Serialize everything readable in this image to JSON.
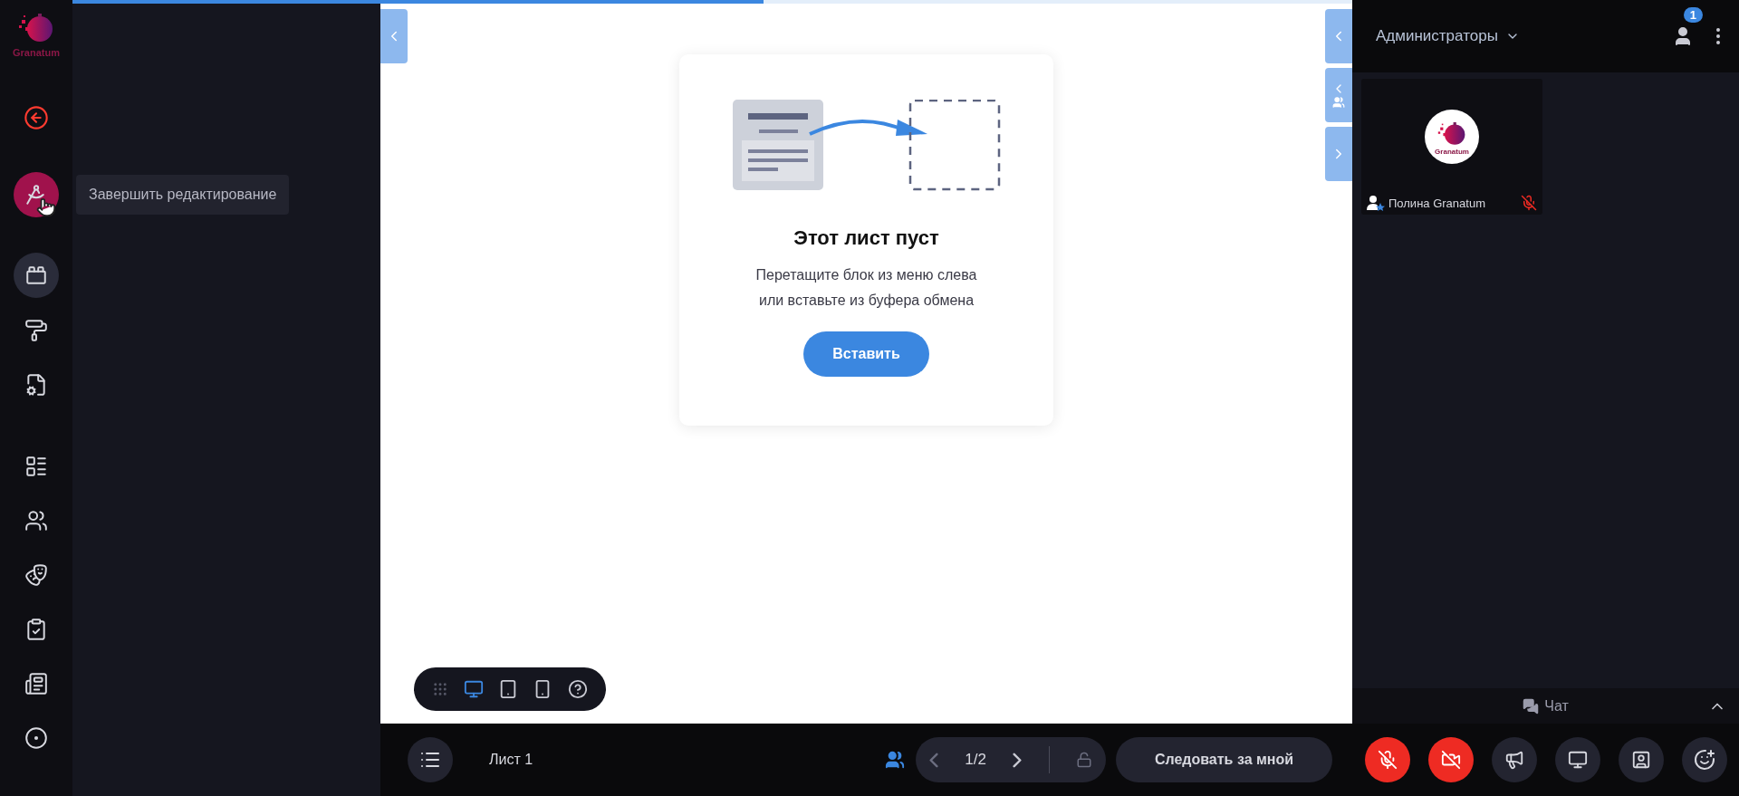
{
  "progress": {
    "level": 0.54
  },
  "rail": {
    "logo_text": "Granatum",
    "finish_editing": {
      "hovered": true
    },
    "items": [
      {
        "selected": true
      },
      {
        "selected": false
      },
      {
        "selected": false
      },
      {
        "selected": false
      },
      {
        "selected": false
      },
      {
        "selected": false
      },
      {
        "selected": false
      },
      {
        "selected": false
      },
      {
        "selected": false
      }
    ]
  },
  "tooltip": "Завершить редактирование",
  "canvas": {
    "title": "Этот лист пуст",
    "hint_lines": [
      "Перетащите блок из меню слева",
      "или вставьте из буфера обмена"
    ],
    "button": "Вставить"
  },
  "view_modes": [
    {
      "selected": true
    },
    {
      "selected": false
    },
    {
      "selected": false
    }
  ],
  "right_panel": {
    "group": "Администраторы",
    "participants_count": "1",
    "participants": [
      {
        "name": "Полина Granatum",
        "avatar_text": "Granatum",
        "muted": true
      }
    ],
    "chat": "Чат"
  },
  "bottom_bar": {
    "sheet": "Лист 1",
    "page": "1/2",
    "follow": "Следовать за мной",
    "mic_on": false,
    "camera_on": false
  }
}
